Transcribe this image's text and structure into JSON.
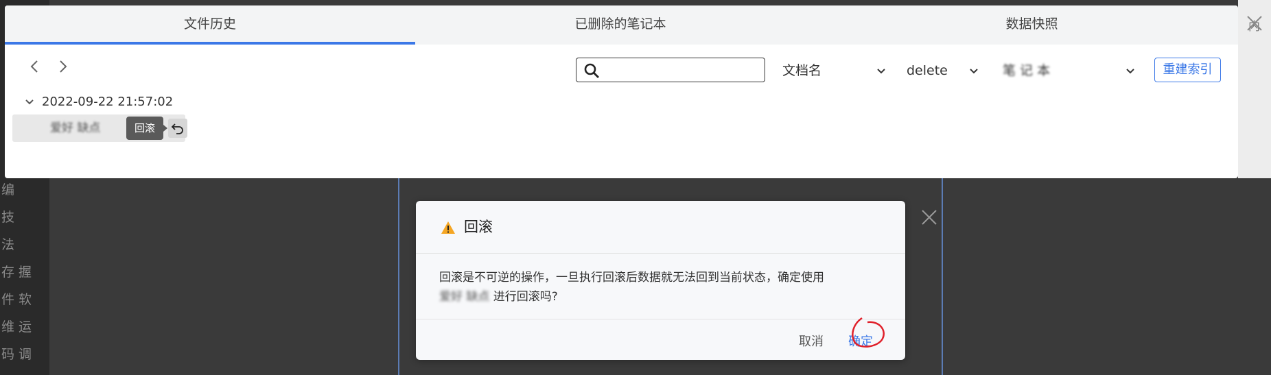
{
  "background": {
    "left_fragments": [
      "编",
      "技",
      "法",
      "存 握",
      "件 软",
      "维 运",
      "码 调"
    ],
    "top_right_fragment": "内"
  },
  "tabs": [
    {
      "label": "文件历史",
      "active": true
    },
    {
      "label": "已删除的笔记本",
      "active": false
    },
    {
      "label": "数据快照",
      "active": false
    }
  ],
  "toolbar": {
    "search": {
      "value": "",
      "placeholder": ""
    },
    "type_select": "文档名",
    "op_select": "delete",
    "notebook_select": "笔 记 本",
    "rebuild_label": "重建索引"
  },
  "history": {
    "group_label": "2022-09-22 21:57:02",
    "entry_label": "爱好 缺点",
    "tooltip": "回滚"
  },
  "dialog": {
    "title": "回滚",
    "body_line1": "回滚是不可逆的操作，一旦执行回滚后数据就无法回到当前状态，确定使用",
    "redacted_name": "爱好 缺点",
    "body_line2_suffix": " 进行回滚吗?",
    "cancel_label": "取消",
    "ok_label": "确定"
  },
  "colors": {
    "accent": "#3b78e7",
    "warning": "#f5a623",
    "annotation": "#e0202a"
  }
}
